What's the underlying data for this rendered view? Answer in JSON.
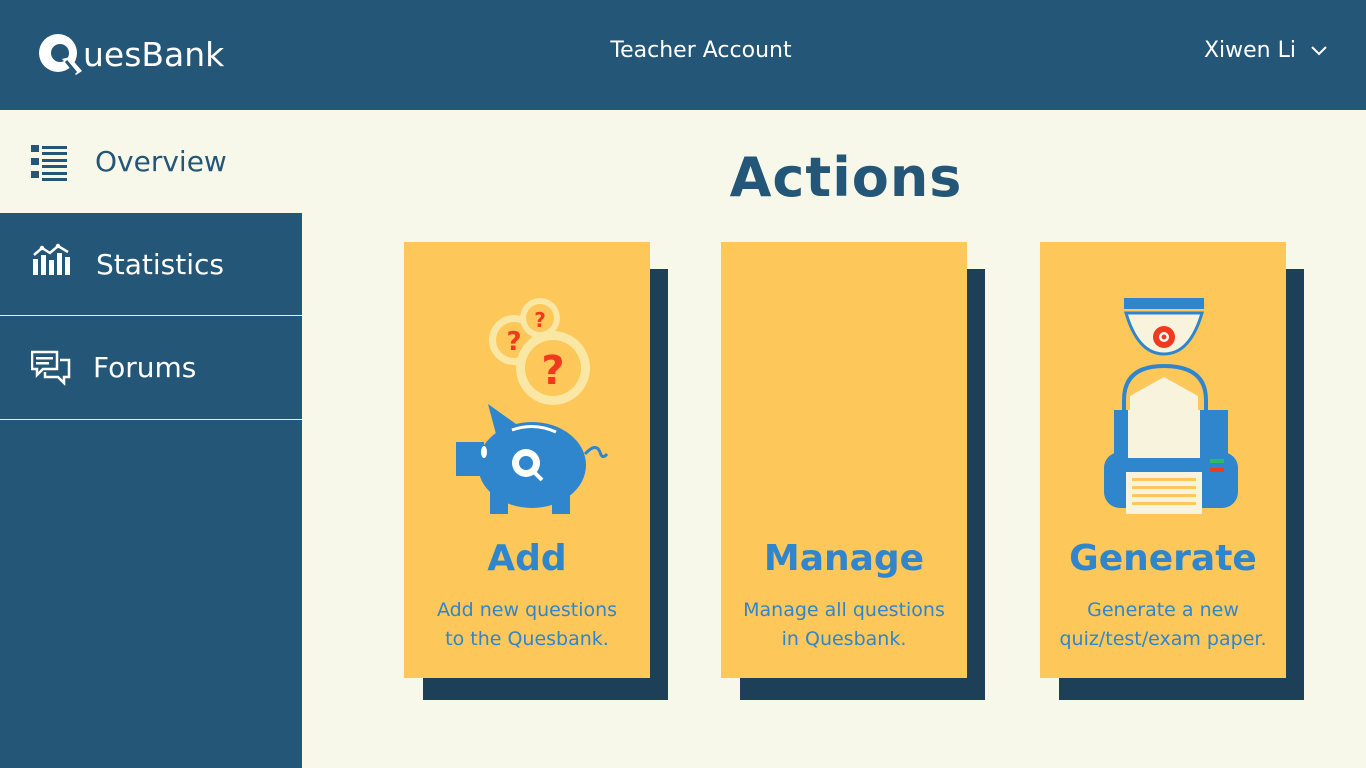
{
  "brand": {
    "logo_text": "uesBank"
  },
  "header": {
    "account_type": "Teacher Account",
    "user_name": "Xiwen Li"
  },
  "sidebar": {
    "items": [
      {
        "label": "Overview",
        "icon": "list-icon",
        "active": true
      },
      {
        "label": "Statistics",
        "icon": "chart-icon",
        "active": false
      },
      {
        "label": "Forums",
        "icon": "chat-icon",
        "active": false
      }
    ]
  },
  "main": {
    "title": "Actions",
    "cards": [
      {
        "title": "Add",
        "description": "Add new questions\nto the Quesbank.",
        "icon": "piggy-bank-icon"
      },
      {
        "title": "Manage",
        "description": "Manage all questions\nin Quesbank.",
        "icon": ""
      },
      {
        "title": "Generate",
        "description": "Generate a new\nquiz/test/exam paper.",
        "icon": "printer-icon"
      }
    ]
  },
  "colors": {
    "primary": "#245677",
    "background": "#f7f8ea",
    "card": "#fdc75a",
    "card_shadow": "#1d3f57",
    "accent": "#2f86cc",
    "question_red": "#f0391f"
  }
}
